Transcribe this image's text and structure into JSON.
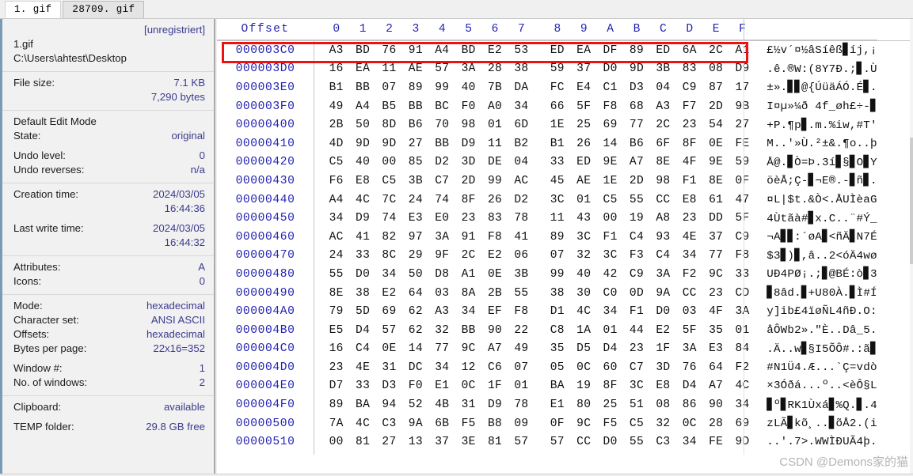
{
  "tabs": [
    {
      "label": "1. gif",
      "active": true
    },
    {
      "label": "28709. gif",
      "active": false
    }
  ],
  "sidebar": {
    "registration": "[unregistriert]",
    "filename": "1.gif",
    "filepath": "C:\\Users\\ahtest\\Desktop",
    "filesize_label": "File size:",
    "filesize_value": "7.1 KB",
    "filesize_bytes": "7,290 bytes",
    "edit_mode_title": "Default Edit Mode",
    "state_label": "State:",
    "state_value": "original",
    "undo_level_label": "Undo level:",
    "undo_level_value": "0",
    "undo_reverses_label": "Undo reverses:",
    "undo_reverses_value": "n/a",
    "creation_time_label": "Creation time:",
    "creation_time_date": "2024/03/05",
    "creation_time_clock": "16:44:36",
    "last_write_label": "Last write time:",
    "last_write_date": "2024/03/05",
    "last_write_clock": "16:44:32",
    "attributes_label": "Attributes:",
    "attributes_value": "A",
    "icons_label": "Icons:",
    "icons_value": "0",
    "mode_label": "Mode:",
    "mode_value": "hexadecimal",
    "charset_label": "Character set:",
    "charset_value": "ANSI ASCII",
    "offsets_label": "Offsets:",
    "offsets_value": "hexadecimal",
    "bytes_per_page_label": "Bytes per page:",
    "bytes_per_page_value": "22x16=352",
    "window_num_label": "Window #:",
    "window_num_value": "1",
    "num_windows_label": "No. of windows:",
    "num_windows_value": "2",
    "clipboard_label": "Clipboard:",
    "clipboard_value": "available",
    "temp_folder_label": "TEMP folder:",
    "temp_folder_value": "29.8 GB free"
  },
  "hex": {
    "offset_header": "Offset",
    "column_headers": [
      "0",
      "1",
      "2",
      "3",
      "4",
      "5",
      "6",
      "7",
      "8",
      "9",
      "A",
      "B",
      "C",
      "D",
      "E",
      "F"
    ],
    "rows": [
      {
        "offset": "000003C0",
        "bytes": [
          "A3",
          "BD",
          "76",
          "91",
          "A4",
          "BD",
          "E2",
          "53",
          "ED",
          "EA",
          "DF",
          "89",
          "ED",
          "6A",
          "2C",
          "A1"
        ],
        "ascii": "£½v´¤½âSíêß▊íj,¡",
        "highlighted": true
      },
      {
        "offset": "000003D0",
        "bytes": [
          "16",
          "EA",
          "11",
          "AE",
          "57",
          "3A",
          "28",
          "38",
          "59",
          "37",
          "D0",
          "9D",
          "3B",
          "83",
          "08",
          "D9"
        ],
        "ascii": ".ê.®W:(8Y7Ð.;▊.Ù",
        "highlighted": false
      },
      {
        "offset": "000003E0",
        "bytes": [
          "B1",
          "BB",
          "07",
          "89",
          "99",
          "40",
          "7B",
          "DA",
          "FC",
          "E4",
          "C1",
          "D3",
          "04",
          "C9",
          "87",
          "17"
        ],
        "ascii": "±».▊▊@{ÚüäÁÓ.É▊.",
        "highlighted": false
      },
      {
        "offset": "000003F0",
        "bytes": [
          "49",
          "A4",
          "B5",
          "BB",
          "BC",
          "F0",
          "A0",
          "34",
          "66",
          "5F",
          "F8",
          "68",
          "A3",
          "F7",
          "2D",
          "9B"
        ],
        "ascii": "I¤µ»¼ð 4f_øh£÷-▊",
        "highlighted": false
      },
      {
        "offset": "00000400",
        "bytes": [
          "2B",
          "50",
          "8D",
          "B6",
          "70",
          "98",
          "01",
          "6D",
          "1E",
          "25",
          "69",
          "77",
          "2C",
          "23",
          "54",
          "27"
        ],
        "ascii": "+P.¶p▊.m.%iw,#T'",
        "highlighted": false
      },
      {
        "offset": "00000410",
        "bytes": [
          "4D",
          "9D",
          "9D",
          "27",
          "BB",
          "D9",
          "11",
          "B2",
          "B1",
          "26",
          "14",
          "B6",
          "6F",
          "8F",
          "0E",
          "FE"
        ],
        "ascii": "M..'»Ù.²±&.¶o..þ",
        "highlighted": false
      },
      {
        "offset": "00000420",
        "bytes": [
          "C5",
          "40",
          "00",
          "85",
          "D2",
          "3D",
          "DE",
          "04",
          "33",
          "ED",
          "9E",
          "A7",
          "8E",
          "4F",
          "9E",
          "59"
        ],
        "ascii": "Å@.▊Ò=Þ.3í▊§▊O▊Y",
        "highlighted": false
      },
      {
        "offset": "00000430",
        "bytes": [
          "F6",
          "E8",
          "C5",
          "3B",
          "C7",
          "2D",
          "99",
          "AC",
          "45",
          "AE",
          "1E",
          "2D",
          "98",
          "F1",
          "8E",
          "0F"
        ],
        "ascii": "öèÅ;Ç-▊¬E®.-▊ñ▊.",
        "highlighted": false
      },
      {
        "offset": "00000440",
        "bytes": [
          "A4",
          "4C",
          "7C",
          "24",
          "74",
          "8F",
          "26",
          "D2",
          "3C",
          "01",
          "C5",
          "55",
          "CC",
          "E8",
          "61",
          "47"
        ],
        "ascii": "¤L|$t.&Ò<.ÅUÌèaG",
        "highlighted": false
      },
      {
        "offset": "00000450",
        "bytes": [
          "34",
          "D9",
          "74",
          "E3",
          "E0",
          "23",
          "83",
          "78",
          "11",
          "43",
          "00",
          "19",
          "A8",
          "23",
          "DD",
          "5F"
        ],
        "ascii": "4Ùtãà#▊x.C..¨#Ý_",
        "highlighted": false
      },
      {
        "offset": "00000460",
        "bytes": [
          "AC",
          "41",
          "82",
          "97",
          "3A",
          "91",
          "F8",
          "41",
          "89",
          "3C",
          "F1",
          "C4",
          "93",
          "4E",
          "37",
          "C9"
        ],
        "ascii": "¬A▊▊:´øA▊<ñÄ▊N7É",
        "highlighted": false
      },
      {
        "offset": "00000470",
        "bytes": [
          "24",
          "33",
          "8C",
          "29",
          "9F",
          "2C",
          "E2",
          "06",
          "07",
          "32",
          "3C",
          "F3",
          "C4",
          "34",
          "77",
          "F8"
        ],
        "ascii": "$3▊)▊,â..2<óÄ4wø",
        "highlighted": false
      },
      {
        "offset": "00000480",
        "bytes": [
          "55",
          "D0",
          "34",
          "50",
          "D8",
          "A1",
          "0E",
          "3B",
          "99",
          "40",
          "42",
          "C9",
          "3A",
          "F2",
          "9C",
          "33"
        ],
        "ascii": "UÐ4PØ¡.;▊@BÉ:ò▊3",
        "highlighted": false
      },
      {
        "offset": "00000490",
        "bytes": [
          "8E",
          "38",
          "E2",
          "64",
          "03",
          "8A",
          "2B",
          "55",
          "38",
          "30",
          "C0",
          "0D",
          "9A",
          "CC",
          "23",
          "CD"
        ],
        "ascii": "▊8âd.▊+U80À.▊Ì#Í",
        "highlighted": false
      },
      {
        "offset": "000004A0",
        "bytes": [
          "79",
          "5D",
          "69",
          "62",
          "A3",
          "34",
          "EF",
          "F8",
          "D1",
          "4C",
          "34",
          "F1",
          "D0",
          "03",
          "4F",
          "3A"
        ],
        "ascii": "y]ib£4ïøÑL4ñÐ.O:",
        "highlighted": false
      },
      {
        "offset": "000004B0",
        "bytes": [
          "E5",
          "D4",
          "57",
          "62",
          "32",
          "BB",
          "90",
          "22",
          "C8",
          "1A",
          "01",
          "44",
          "E2",
          "5F",
          "35",
          "01"
        ],
        "ascii": "åÔWb2».\"È..Dâ_5.",
        "highlighted": false
      },
      {
        "offset": "000004C0",
        "bytes": [
          "16",
          "C4",
          "0E",
          "14",
          "77",
          "9C",
          "A7",
          "49",
          "35",
          "D5",
          "D4",
          "23",
          "1F",
          "3A",
          "E3",
          "84"
        ],
        "ascii": ".Ä..w▊§I5ÕÔ#.:ã▊",
        "highlighted": false
      },
      {
        "offset": "000004D0",
        "bytes": [
          "23",
          "4E",
          "31",
          "DC",
          "34",
          "12",
          "C6",
          "07",
          "05",
          "0C",
          "60",
          "C7",
          "3D",
          "76",
          "64",
          "F2"
        ],
        "ascii": "#N1Ü4.Æ...`Ç=vdò",
        "highlighted": false
      },
      {
        "offset": "000004E0",
        "bytes": [
          "D7",
          "33",
          "D3",
          "F0",
          "E1",
          "0C",
          "1F",
          "01",
          "BA",
          "19",
          "8F",
          "3C",
          "E8",
          "D4",
          "A7",
          "4C"
        ],
        "ascii": "×3Óðá...º..<èÔ§L",
        "highlighted": false
      },
      {
        "offset": "000004F0",
        "bytes": [
          "89",
          "BA",
          "94",
          "52",
          "4B",
          "31",
          "D9",
          "78",
          "E1",
          "80",
          "25",
          "51",
          "08",
          "86",
          "90",
          "34"
        ],
        "ascii": "▊º▊RK1Ùxá▊%Q.▊.4",
        "highlighted": false
      },
      {
        "offset": "00000500",
        "bytes": [
          "7A",
          "4C",
          "C3",
          "9A",
          "6B",
          "F5",
          "B8",
          "09",
          "0F",
          "9C",
          "F5",
          "C5",
          "32",
          "0C",
          "28",
          "69"
        ],
        "ascii": "zLÃ▊kõ¸..▊õÅ2.(i",
        "highlighted": false
      },
      {
        "offset": "00000510",
        "bytes": [
          "00",
          "81",
          "27",
          "13",
          "37",
          "3E",
          "81",
          "57",
          "57",
          "CC",
          "D0",
          "55",
          "C3",
          "34",
          "FE",
          "9D"
        ],
        "ascii": "..'.7>.WWÌÐUÃ4þ.",
        "highlighted": false
      }
    ]
  },
  "watermark": "CSDN @Demons家的猫",
  "colors": {
    "offset_blue": "#2424b4",
    "value_blue": "#3b3b8f",
    "highlight_red": "#ee1111",
    "panel_bg": "#f1f1f1"
  }
}
